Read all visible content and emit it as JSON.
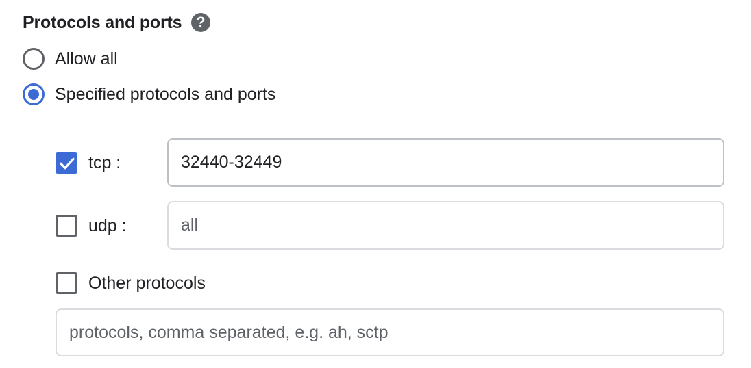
{
  "section": {
    "title": "Protocols and ports",
    "help_icon": "help-circle-icon",
    "help_glyph": "?"
  },
  "radios": {
    "allow_all": {
      "label": "Allow all",
      "checked": false
    },
    "specified": {
      "label": "Specified protocols and ports",
      "checked": true
    }
  },
  "protocols": {
    "tcp": {
      "label": "tcp :",
      "checked": true,
      "value": "32440-32449",
      "placeholder": ""
    },
    "udp": {
      "label": "udp :",
      "checked": false,
      "value": "",
      "placeholder": "all"
    },
    "other": {
      "label": "Other protocols",
      "checked": false,
      "value": "",
      "placeholder": "protocols, comma separated, e.g. ah, sctp"
    }
  },
  "colors": {
    "accent": "#3c6bd5",
    "text": "#202124",
    "icon_gray": "#5f6368",
    "field_border": "#dadce0"
  }
}
